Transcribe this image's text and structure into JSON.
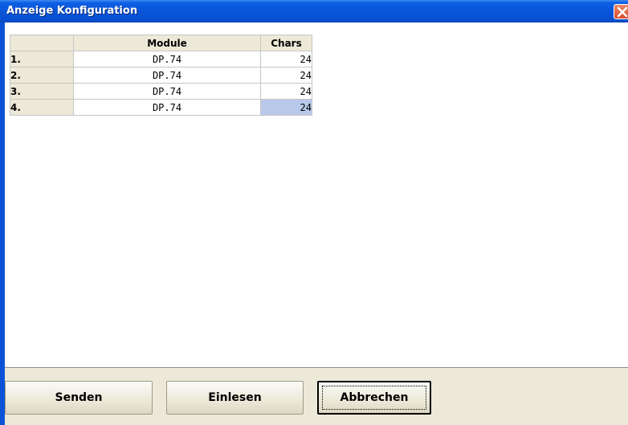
{
  "window": {
    "title": "Anzeige Konfiguration"
  },
  "table": {
    "headers": {
      "module": "Module",
      "chars": "Chars"
    },
    "rows": [
      {
        "index": "1.",
        "module": "DP.74",
        "chars": "24"
      },
      {
        "index": "2.",
        "module": "DP.74",
        "chars": "24"
      },
      {
        "index": "3.",
        "module": "DP.74",
        "chars": "24"
      },
      {
        "index": "4.",
        "module": "DP.74",
        "chars": "24"
      }
    ],
    "selected_cell": {
      "row": 4,
      "column": "Chars"
    }
  },
  "buttons": {
    "send": "Senden",
    "read": "Einlesen",
    "cancel": "Abbrechen"
  },
  "colors": {
    "titlebar": "#0a55d8",
    "panel": "#ece9d8",
    "selection": "#b8c9eb",
    "close": "#d94a2a"
  }
}
